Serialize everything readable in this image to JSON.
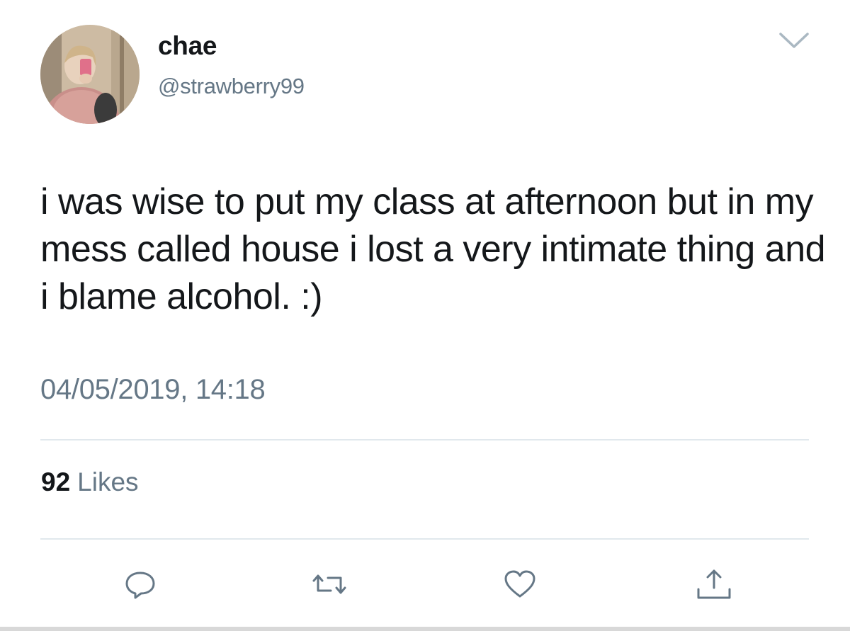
{
  "tweet": {
    "display_name": "chae",
    "handle": "@strawberry99",
    "text": "i was wise to put my class at afternoon but in my mess called house i lost a very intimate thing and i blame alcohol. :)",
    "timestamp": "04/05/2019, 14:18",
    "likes_count": "92",
    "likes_label": "Likes"
  },
  "actions": [
    {
      "name": "reply",
      "icon": "reply-icon"
    },
    {
      "name": "retweet",
      "icon": "retweet-icon"
    },
    {
      "name": "like",
      "icon": "heart-icon"
    },
    {
      "name": "share",
      "icon": "share-icon"
    }
  ],
  "colors": {
    "primary_text": "#14171a",
    "secondary_text": "#657786",
    "divider": "#e1e8ed",
    "icon": "#657786"
  }
}
